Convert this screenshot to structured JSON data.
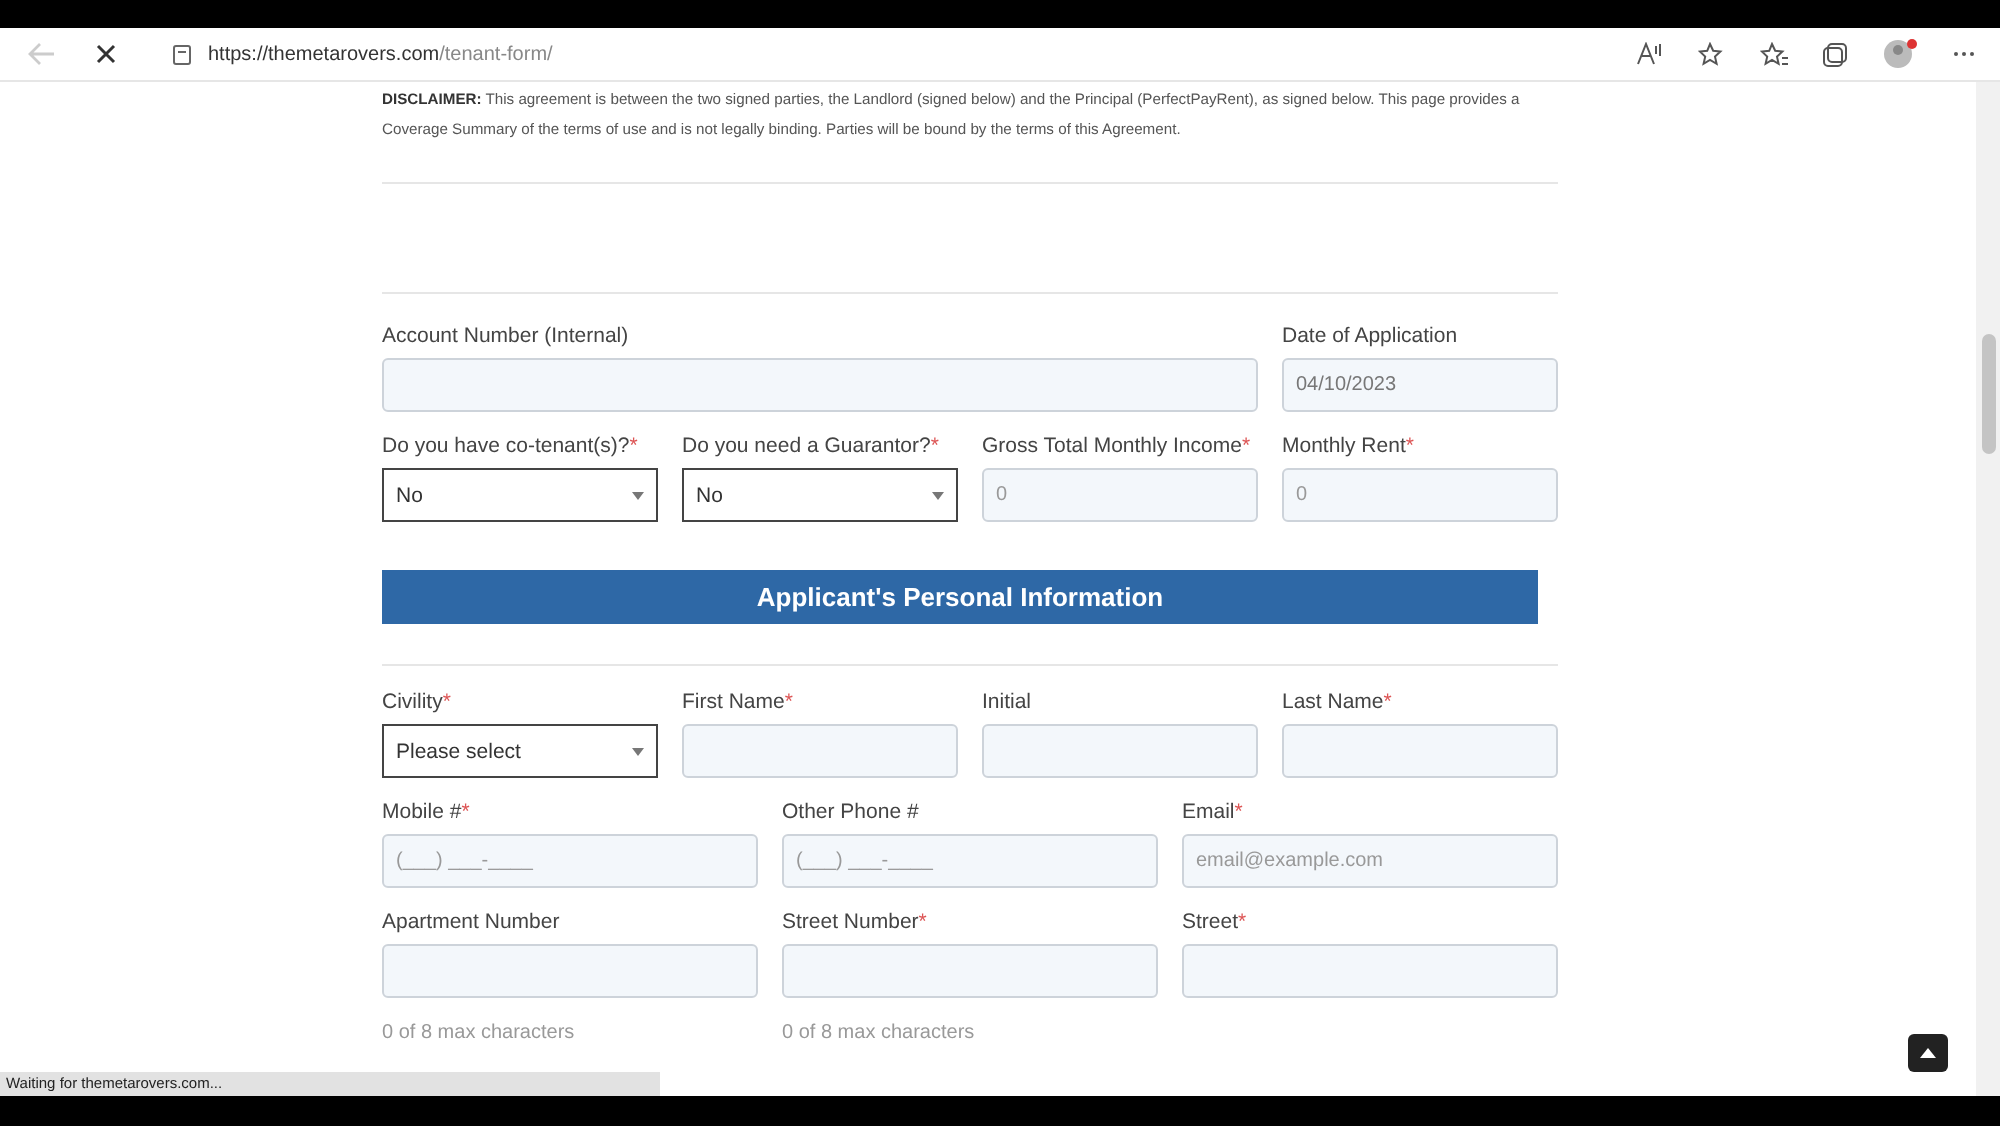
{
  "browser": {
    "url_host": "https://themetarovers.com",
    "url_path": "/tenant-form/",
    "status": "Waiting for themetarovers.com..."
  },
  "disclaimer": {
    "label": "DISCLAIMER:",
    "text": "This agreement is between the two signed parties, the Landlord (signed below) and the Principal (PerfectPayRent), as signed below. This page provides a Coverage Summary of the terms of use and is not legally binding. Parties will be bound by the terms of this Agreement."
  },
  "account_rows": [
    {
      "fields": [
        {
          "label": "Account Number (Internal)",
          "kind": "input"
        },
        {
          "label": "Date of Application",
          "kind": "input",
          "value": "04/10/2023"
        }
      ]
    },
    {
      "fields": [
        {
          "label": "Do you have co-tenant(s)?",
          "required_mark": "*",
          "kind": "select",
          "value": "No"
        },
        {
          "label": "Do you need a Guarantor?",
          "required_mark": "*",
          "kind": "select",
          "value": "No"
        },
        {
          "label": "Gross Total Monthly Income",
          "required_mark": "*",
          "kind": "input",
          "placeholder": "0"
        },
        {
          "label": "Monthly Rent",
          "required_mark": "*",
          "kind": "input",
          "placeholder": "0"
        }
      ]
    }
  ],
  "section_title": "Applicant's Personal Information",
  "personal_rows": [
    {
      "fields": [
        {
          "label": "Civility",
          "required_mark": "*",
          "kind": "select",
          "value": "Please select"
        },
        {
          "label": "First Name",
          "required_mark": "*",
          "kind": "input"
        },
        {
          "label": "Initial",
          "kind": "input"
        },
        {
          "label": "Last Name",
          "required_mark": "*",
          "kind": "input"
        }
      ]
    },
    {
      "fields": [
        {
          "label": "Mobile #",
          "required_mark": "*",
          "kind": "input",
          "placeholder": "(___) ___-____"
        },
        {
          "label": "Other Phone #",
          "kind": "input",
          "placeholder": "(___) ___-____"
        },
        {
          "label": "Email",
          "required_mark": "*",
          "kind": "input",
          "placeholder": "email@example.com"
        }
      ]
    },
    {
      "fields": [
        {
          "label": "Apartment Number",
          "kind": "input",
          "hint": "0 of 8 max characters"
        },
        {
          "label": "Street Number",
          "required_mark": "*",
          "kind": "input",
          "hint": "0 of 8 max characters"
        },
        {
          "label": "Street",
          "required_mark": "*",
          "kind": "input"
        }
      ]
    }
  ]
}
